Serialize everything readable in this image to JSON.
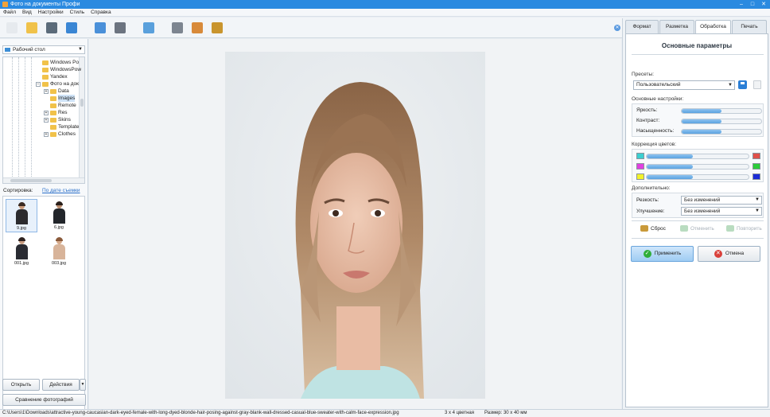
{
  "window": {
    "title": "Фото на документы Профи",
    "controls": [
      "–",
      "□",
      "✕"
    ]
  },
  "menu": [
    "Файл",
    "Вид",
    "Настройки",
    "Стиль",
    "Справка"
  ],
  "toolbar": {
    "buttons": [
      {
        "icon": "new-file-icon",
        "color": "#e6eaee"
      },
      {
        "icon": "open-folder-icon",
        "color": "#f0c24a"
      },
      {
        "icon": "save-disk-icon",
        "color": "#5b6b7a"
      },
      {
        "icon": "print-icon",
        "color": "#3a86d4"
      },
      {
        "icon": "person-icon",
        "color": "#4a90d9"
      },
      {
        "icon": "camera-icon",
        "color": "#6c7480"
      },
      {
        "icon": "picture-icon",
        "color": "#5aa0dc"
      },
      {
        "icon": "film-reel-icon",
        "color": "#7d8590"
      },
      {
        "icon": "printer-pen-icon",
        "color": "#d88a3a"
      },
      {
        "icon": "layers-icon",
        "color": "#c9952e"
      }
    ],
    "close_symbol": "✕"
  },
  "left": {
    "folder": "Рабочий стол",
    "tree": [
      {
        "label": "Windows Po",
        "level": 0,
        "expand": ""
      },
      {
        "label": "WindowsPow",
        "level": 0,
        "expand": ""
      },
      {
        "label": "Yandex",
        "level": 0,
        "expand": ""
      },
      {
        "label": "Фото на док",
        "level": 0,
        "expand": "−"
      },
      {
        "label": "Data",
        "level": 1,
        "expand": "+"
      },
      {
        "label": "Images",
        "level": 1,
        "expand": ""
      },
      {
        "label": "Remote",
        "level": 1,
        "expand": ""
      },
      {
        "label": "Res",
        "level": 1,
        "expand": "+"
      },
      {
        "label": "Skins",
        "level": 1,
        "expand": "+"
      },
      {
        "label": "Template",
        "level": 1,
        "expand": ""
      },
      {
        "label": "Clothes",
        "level": 1,
        "expand": "+"
      }
    ],
    "sort_label": "Сортировка:",
    "sort_value": "По дате съемки",
    "thumbnails": [
      {
        "name": "9.jpg",
        "hair": "#3a2a22",
        "body": "#2b2b2e",
        "skin": "#c99a7a"
      },
      {
        "name": "6.jpg",
        "hair": "#2a1f1a",
        "body": "#23262b",
        "skin": "#b98b6d"
      },
      {
        "name": "001.jpg",
        "hair": "#2e2220",
        "body": "#2a2c33",
        "skin": "#c89c80"
      },
      {
        "name": "003.jpg",
        "hair": "#8a5a3a",
        "body": "#d8b49a",
        "skin": "#d6a98a"
      }
    ],
    "open_label": "Открыть",
    "actions_label": "Действия",
    "actions_arrow": "▼",
    "compare_label": "Сравнение фотографий"
  },
  "tabs": [
    "Формат",
    "Разметка",
    "Обработка",
    "Печать"
  ],
  "right": {
    "title": "Основные параметры",
    "presets_label": "Пресеты:",
    "preset_value": "Пользовательский",
    "basic_label": "Основные настройки:",
    "sliders": [
      {
        "label": "Яркость:",
        "value": 0.5
      },
      {
        "label": "Контраст:",
        "value": 0.5
      },
      {
        "label": "Насыщенность:",
        "value": 0.5
      }
    ],
    "color_label": "Коррекция цветов:",
    "color_rows": [
      {
        "left": "#3ccfd0",
        "right": "#e0504a",
        "value": 0.45
      },
      {
        "left": "#e040e0",
        "right": "#2ccc3a",
        "value": 0.45
      },
      {
        "left": "#f2f22a",
        "right": "#1a2cd6",
        "value": 0.45
      }
    ],
    "extra_label": "Дополнительно:",
    "sharpness_label": "Резкость:",
    "sharpness_value": "Без изменений",
    "enhance_label": "Улучшение:",
    "enhance_value": "Без изменений",
    "reset_label": "Сброс",
    "undo_label": "Отменить",
    "redo_label": "Повторить",
    "apply_label": "Применить",
    "cancel_label": "Отмена",
    "dropdown_arrow": "▼"
  },
  "status": {
    "path": "C:\\Users\\1\\Downloads\\attractive-young-caucasian-dark-eyed-female-with-long-dyed-blonde-hair-posing-against-gray-blank-wall-dressed-casual-blue-sweater-with-calm-face-expression.jpg",
    "format": "3 x 4 цветная",
    "size": "Размер: 30 x 40 мм"
  }
}
